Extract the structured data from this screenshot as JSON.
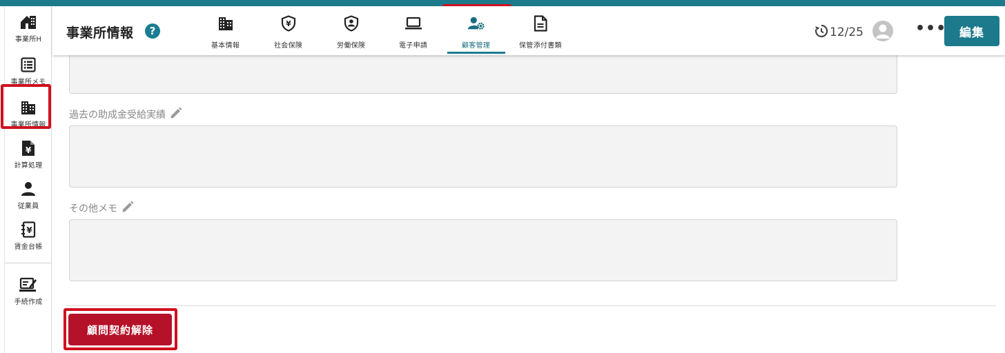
{
  "app": {
    "page_title": "事業所情報",
    "help_symbol": "?"
  },
  "sidebar": {
    "items": [
      {
        "label": "事業所H",
        "icon": "home-building-icon"
      },
      {
        "label": "事業所メモ",
        "icon": "list-memo-icon"
      },
      {
        "label": "事業所情報",
        "icon": "office-building-icon",
        "active": true
      },
      {
        "label": "計算処理",
        "icon": "yen-document-icon"
      },
      {
        "label": "従業員",
        "icon": "person-icon"
      },
      {
        "label": "賃金台帳",
        "icon": "yen-ledger-icon"
      },
      {
        "label": "手続作成",
        "icon": "edit-form-icon"
      }
    ]
  },
  "tabs": [
    {
      "label": "基本情報",
      "icon": "building-icon"
    },
    {
      "label": "社会保険",
      "icon": "yen-shield-icon"
    },
    {
      "label": "労働保険",
      "icon": "person-shield-icon"
    },
    {
      "label": "電子申請",
      "icon": "laptop-icon"
    },
    {
      "label": "顧客管理",
      "icon": "user-gear-icon",
      "active": true
    },
    {
      "label": "保管添付書類",
      "icon": "document-icon"
    }
  ],
  "header_right": {
    "history_text": "12/25",
    "more_label": "•••",
    "edit_label": "編集"
  },
  "fields": [
    {
      "label": "",
      "value": ""
    },
    {
      "label": "過去の助成金受給実績",
      "value": ""
    },
    {
      "label": "その他メモ",
      "value": ""
    }
  ],
  "actions": {
    "terminate_label": "顧問契約解除"
  },
  "colors": {
    "accent": "#1c7a8c",
    "danger": "#b5122a",
    "highlight": "#d0101e"
  }
}
